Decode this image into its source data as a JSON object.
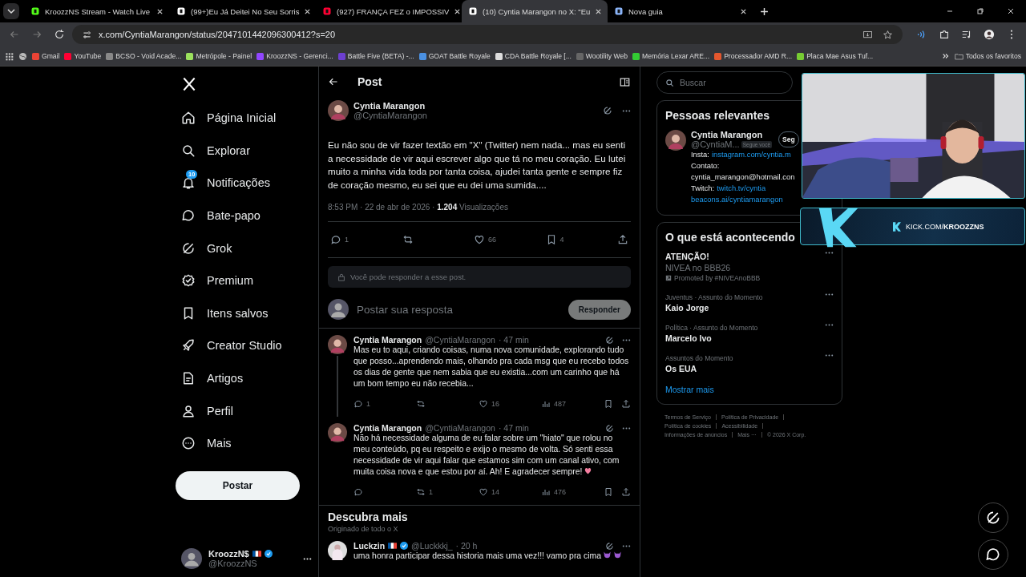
{
  "browser": {
    "tabs": [
      {
        "title": "KroozzNS Stream - Watch Live",
        "selected": false
      },
      {
        "title": "(99+)Eu Já Deitei No Seu Sorris",
        "selected": false
      },
      {
        "title": "(927) FRANÇA FEZ o IMPOSSIV",
        "selected": false
      },
      {
        "title": "(10) Cyntia Marangon no X: \"Eu",
        "selected": true
      },
      {
        "title": "Nova guia",
        "selected": false
      }
    ],
    "url": "x.com/CyntiaMarangon/status/2047101442096300412?s=20",
    "bookmarks": [
      "Gmail",
      "YouTube",
      "BCSO - Void Acade...",
      "Metrópole - Painel",
      "KroozzNS - Gerenci...",
      "Battle Five (BETA) -...",
      "GOAT Battle Royale",
      "CDA Battle Royale [...",
      "Wootility Web",
      "Memória Lexar ARE...",
      "Processador AMD R...",
      "Placa Mae Asus Tuf..."
    ],
    "all_bookmarks": "Todos os favoritos"
  },
  "nav": {
    "items": [
      {
        "label": "Página Inicial"
      },
      {
        "label": "Explorar"
      },
      {
        "label": "Notificações",
        "badge": "10"
      },
      {
        "label": "Bate-papo"
      },
      {
        "label": "Grok"
      },
      {
        "label": "Premium"
      },
      {
        "label": "Itens salvos"
      },
      {
        "label": "Creator Studio"
      },
      {
        "label": "Artigos"
      },
      {
        "label": "Perfil"
      },
      {
        "label": "Mais"
      }
    ],
    "post_button": "Postar",
    "account": {
      "name": "KroozzN$",
      "handle": "@KroozzNS"
    }
  },
  "main": {
    "title": "Post",
    "post": {
      "name": "Cyntia Marangon",
      "handle": "@CyntiaMarangon",
      "text": "Eu não sou de vir fazer textão em \"X\" (Twitter) nem nada... mas eu senti a necessidade de vir aqui escrever algo que tá no meu coração. Eu lutei muito a minha vida toda por tanta coisa, ajudei tanta gente e sempre fiz de coração mesmo, eu sei que eu dei uma sumida....",
      "time": "8:53 PM · 22 de abr de 2026 ·",
      "views": "1.204",
      "views_label": "Visualizações",
      "replies": "1",
      "likes": "66",
      "bookmarks": "4"
    },
    "reply_notice": "Você pode responder a esse post.",
    "composer": {
      "placeholder": "Postar sua resposta",
      "button": "Responder"
    },
    "replies": [
      {
        "name": "Cyntia Marangon",
        "handle": "@CyntiaMarangon",
        "time": "· 47 min",
        "text": "Mas eu to aqui, criando coisas, numa nova comunidade, explorando tudo que posso...aprendendo mais, olhando pra cada msg que eu recebo todos os dias de gente que nem sabia que eu existia...com um carinho que há um bom tempo eu não recebia...",
        "replies": "1",
        "likes": "16",
        "views": "487",
        "heart": false
      },
      {
        "name": "Cyntia Marangon",
        "handle": "@CyntiaMarangon",
        "time": "· 47 min",
        "text": "Não há necessidade alguma de eu falar sobre um \"hiato\" que rolou no meu conteúdo, pq eu respeito e exijo o mesmo de volta. Só senti essa necessidade de vir aqui falar que estamos sim com um canal ativo, com muita coisa nova e que estou por aí. Ah! E agradecer sempre!",
        "reposts": "1",
        "likes": "14",
        "views": "476",
        "heart": true
      }
    ],
    "discover": {
      "title": "Descubra mais",
      "subtitle": "Originado de todo o X",
      "tweet": {
        "name": "Luckzin",
        "handle": "@Luckkkj_",
        "time": "· 20 h",
        "text": "uma honra participar dessa historia mais uma vez!!! vamo pra cima"
      }
    }
  },
  "right": {
    "search": {
      "placeholder": "Buscar"
    },
    "people": {
      "title": "Pessoas relevantes",
      "name": "Cyntia Marangon",
      "handle": "@CyntiaM...",
      "follows_you": "Segue você",
      "button": "Seg",
      "bio": [
        {
          "label": "Insta:",
          "link": "instagram.com/cyntia.m"
        },
        {
          "label": "Contato:"
        },
        {
          "label": "cyntia_marangon@hotmail.con"
        },
        {
          "label": "Twitch:",
          "link": "twitch.tv/cyntia"
        },
        {
          "link": "beacons.ai/cyntiamarangon"
        }
      ]
    },
    "trends": {
      "title": "O que está acontecendo",
      "items": [
        {
          "kind": "promoted",
          "title": "ATENÇÃO!",
          "subtitle": "NIVEA no BBB26",
          "promoted": "Promoted by #NIVEAnoBBB"
        },
        {
          "kind": "trend",
          "context": "Juventus · Assunto do Momento",
          "title": "Kaio Jorge"
        },
        {
          "kind": "trend",
          "context": "Política · Assunto do Momento",
          "title": "Marcelo Ivo"
        },
        {
          "kind": "trend",
          "context": "Assuntos do Momento",
          "title": "Os EUA"
        }
      ],
      "show_more": "Mostrar mais"
    },
    "footer": [
      "Termos de Serviço",
      "Política de Privacidade",
      "Política de cookies",
      "Acessibilidade",
      "Informações de anúncios",
      "Mais ···"
    ],
    "copyright": "© 2026 X Corp."
  },
  "overlay": {
    "banner": "KICK.COM/**KROOZZNS**"
  }
}
